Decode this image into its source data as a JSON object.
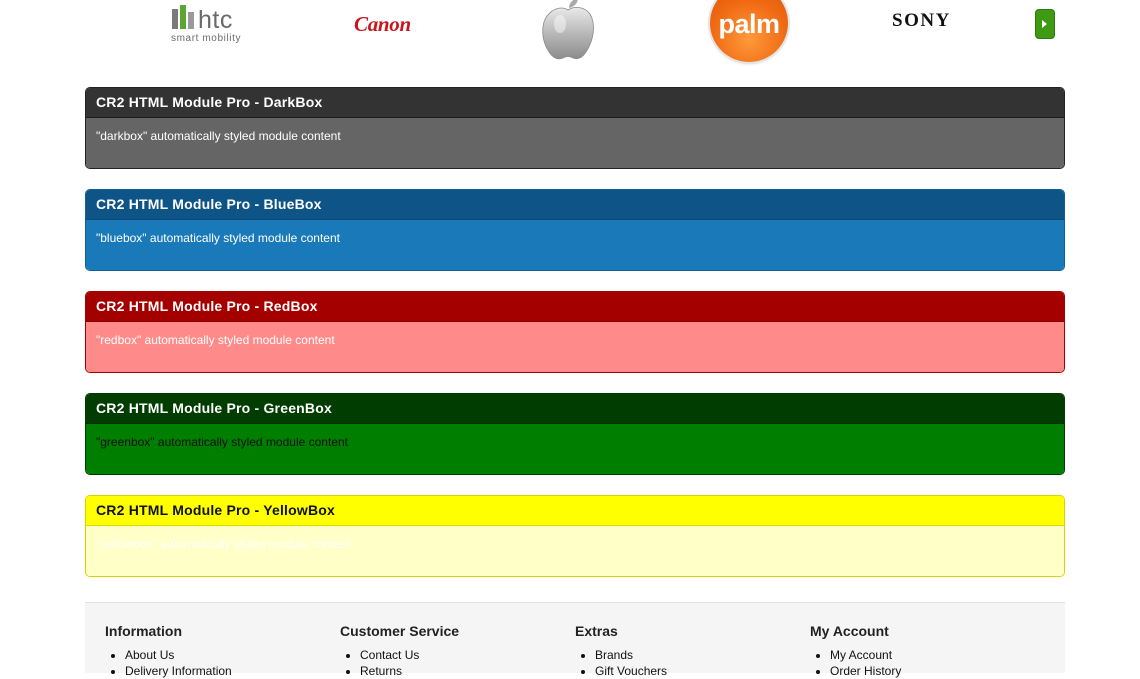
{
  "brands": {
    "htc_word": "htc",
    "htc_tagline": "smart mobility",
    "canon": "Canon",
    "apple_icon": "apple-logo-icon",
    "palm": "palm",
    "sony": "SONY",
    "next_icon": "chevron-right-icon",
    "next_color": "#3d9a12"
  },
  "modules": {
    "dark": {
      "title": "CR2 HTML Module Pro - DarkBox",
      "content": "\"darkbox\" automatically styled module content"
    },
    "blue": {
      "title": "CR2 HTML Module Pro - BlueBox",
      "content": "\"bluebox\" automatically styled module content"
    },
    "red": {
      "title": "CR2 HTML Module Pro - RedBox",
      "content": "\"redbox\" automatically styled module content"
    },
    "green": {
      "title": "CR2 HTML Module Pro - GreenBox",
      "content": "\"greenbox\" automatically styled module content"
    },
    "yellow": {
      "title": "CR2 HTML Module Pro - YellowBox",
      "content": "\"yellowbox\" automatically styled module content"
    }
  },
  "footer": {
    "information": {
      "title": "Information",
      "items": [
        "About Us",
        "Delivery Information"
      ]
    },
    "customer_service": {
      "title": "Customer Service",
      "items": [
        "Contact Us",
        "Returns"
      ]
    },
    "extras": {
      "title": "Extras",
      "items": [
        "Brands",
        "Gift Vouchers"
      ]
    },
    "my_account": {
      "title": "My Account",
      "items": [
        "My Account",
        "Order History"
      ]
    }
  }
}
